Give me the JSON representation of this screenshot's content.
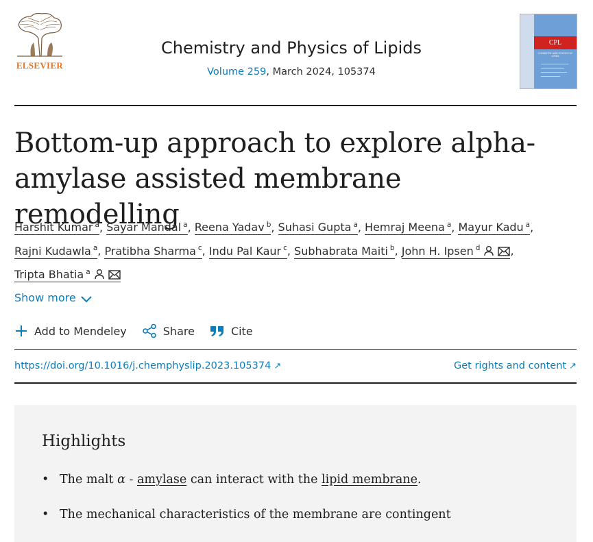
{
  "header": {
    "publisher": "ELSEVIER",
    "journal_title": "Chemistry and Physics of Lipids",
    "volume_link": "Volume 259",
    "issue_rest": ", March 2024, 105374",
    "cover_abbrev": "CPL",
    "cover_subtitle": "CHEMISTRY AND PHYSICS OF LIPIDS"
  },
  "article": {
    "title": "Bottom-up approach to explore alpha-amylase assisted membrane remodelling",
    "authors": [
      {
        "name": "Harshit Kumar",
        "aff": "a"
      },
      {
        "name": "Sayar Mandal",
        "aff": "a"
      },
      {
        "name": "Reena Yadav",
        "aff": "b"
      },
      {
        "name": "Suhasi Gupta",
        "aff": "a"
      },
      {
        "name": "Hemraj Meena",
        "aff": "a"
      },
      {
        "name": "Mayur Kadu",
        "aff": "a"
      },
      {
        "name": "Rajni Kudawla",
        "aff": "a"
      },
      {
        "name": "Pratibha Sharma",
        "aff": "c"
      },
      {
        "name": "Indu Pal Kaur",
        "aff": "c"
      },
      {
        "name": "Subhabrata Maiti",
        "aff": "b"
      },
      {
        "name": "John H. Ipsen",
        "aff": "d"
      },
      {
        "name": "Tripta Bhatia",
        "aff": "a"
      }
    ],
    "show_more": "Show more",
    "actions": {
      "mendeley": "Add to Mendeley",
      "share": "Share",
      "cite": "Cite"
    },
    "doi": "https://doi.org/10.1016/j.chemphyslip.2023.105374",
    "rights": "Get rights and content"
  },
  "highlights": {
    "title": "Highlights",
    "h1": {
      "pre": "The malt ",
      "alpha": "α",
      "dash": " - ",
      "link1": "amylase",
      "mid": " can interact with the ",
      "link2": "lipid membrane",
      "end": "."
    },
    "h2": "The mechanical characteristics of the membrane are contingent"
  },
  "colors": {
    "link": "#0c7dbb",
    "publisher_orange": "#e9711c",
    "highlight_bg": "#f3f3f3"
  }
}
